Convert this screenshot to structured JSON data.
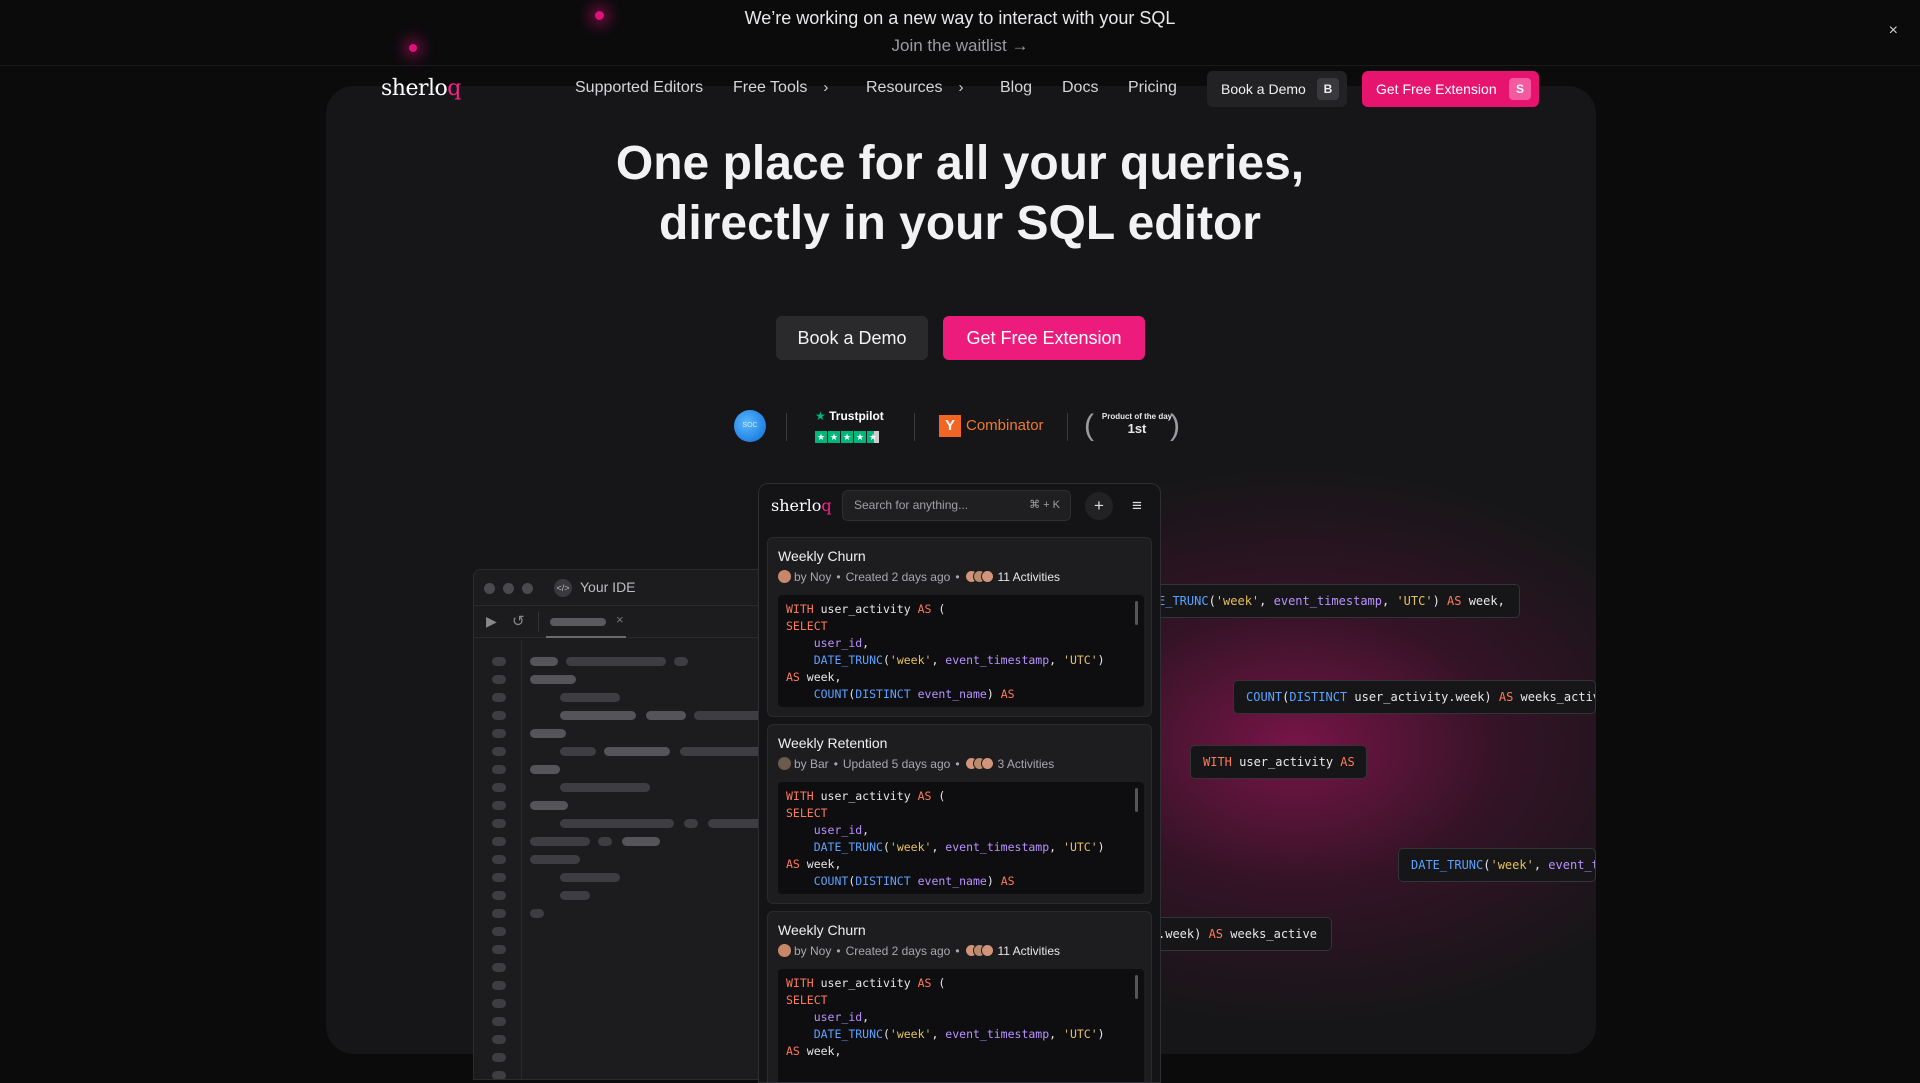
{
  "banner": {
    "title": "We’re working on a new way to interact with your SQL",
    "link": "Join the waitlist →",
    "close": "×"
  },
  "nav": {
    "logo": "sherlo",
    "logo_accent": "q",
    "items": [
      "Supported Editors",
      "Free Tools",
      "Resources",
      "Blog",
      "Docs",
      "Pricing"
    ],
    "book_demo": "Book a Demo",
    "book_demo_key": "B",
    "get_extension": "Get Free Extension",
    "get_extension_key": "S"
  },
  "hero": {
    "line1": "One place for all your queries,",
    "line2": "directly in your SQL editor",
    "cta_demo": "Book a Demo",
    "cta_extension": "Get Free Extension"
  },
  "badges": {
    "trustpilot": "Trustpilot",
    "yc_letter": "Y",
    "yc_name": "Combinator",
    "ph_label": "Product of the day",
    "ph_rank": "1st"
  },
  "ide": {
    "title": "Your IDE",
    "tab_close": "×"
  },
  "app": {
    "logo": "sherlo",
    "logo_accent": "q",
    "search_placeholder": "Search for anything...",
    "search_shortcut": "⌘ + K",
    "add_icon": "+",
    "menu_icon": "≡",
    "cards": [
      {
        "title": "Weekly Churn",
        "by": "by Noy",
        "time": "Created 2 days ago",
        "activities": "11 Activities"
      },
      {
        "title": "Weekly Retention",
        "by": "by Bar",
        "time": "Updated 5 days ago",
        "activities": "3 Activities"
      },
      {
        "title": "Weekly Churn",
        "by": "by Noy",
        "time": "Created 2 days ago",
        "activities": "11 Activities"
      }
    ]
  },
  "chips": [
    "E_TRUNC('week', event_timestamp, 'UTC') AS week,",
    "COUNT(DISTINCT user_activity.week) AS weeks_activ",
    "WITH user_activity AS",
    "DATE_TRUNC('week', event_t",
    ".week) AS weeks_active"
  ],
  "colors": {
    "accent": "#e6136f",
    "background": "#0b0b0c",
    "panel": "#161618"
  }
}
